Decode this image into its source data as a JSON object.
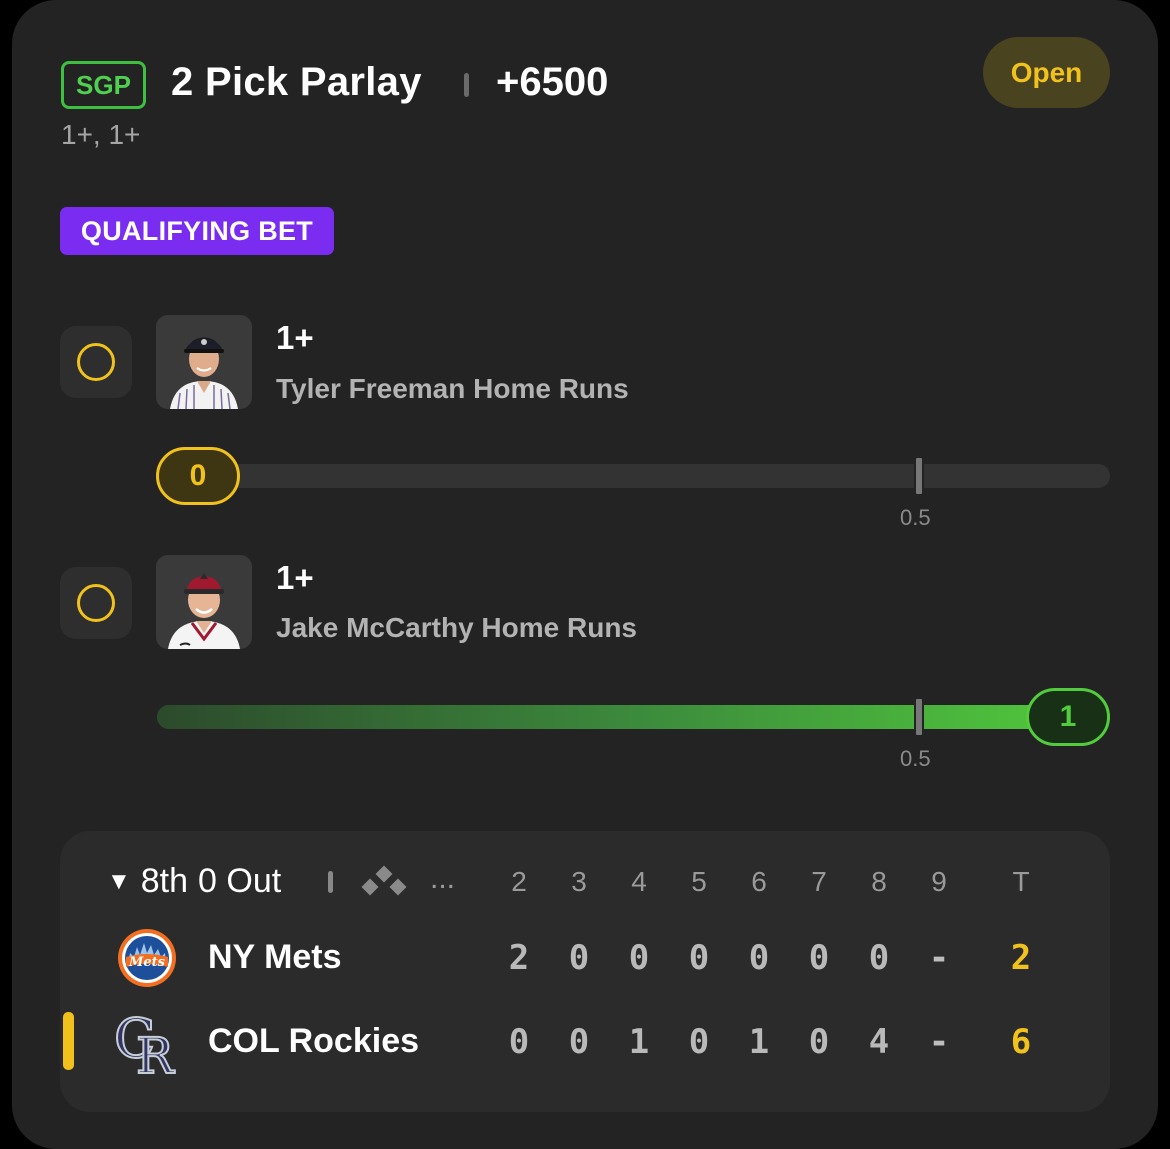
{
  "header": {
    "tag": "SGP",
    "title": "2 Pick Parlay",
    "odds": "+6500",
    "subline": "1+, 1+",
    "status": "Open"
  },
  "promo_badge": "QUALIFYING BET",
  "picks": [
    {
      "line": "1+",
      "description": "Tyler Freeman Home Runs",
      "current_value": "0",
      "target_label": "0.5",
      "progress_fraction": 0.0,
      "status_color": "#f1c21b"
    },
    {
      "line": "1+",
      "description": "Jake McCarthy Home Runs",
      "current_value": "1",
      "target_label": "0.5",
      "progress_fraction": 1.0,
      "status_color": "#52cc3c"
    }
  ],
  "scoreboard": {
    "inning": "8th",
    "outs": "0 Out",
    "ellipsis": "...",
    "innings": [
      "2",
      "3",
      "4",
      "5",
      "6",
      "7",
      "8",
      "9"
    ],
    "total_label": "T",
    "teams": [
      {
        "name": "NY Mets",
        "scores": [
          "2",
          "0",
          "0",
          "0",
          "0",
          "0",
          "0",
          "-"
        ],
        "total": "2",
        "logo": "mets-logo"
      },
      {
        "name": "COL Rockies",
        "scores": [
          "0",
          "0",
          "1",
          "0",
          "1",
          "0",
          "4",
          "-"
        ],
        "total": "6",
        "logo": "rockies-logo"
      }
    ]
  },
  "colors": {
    "accent_yellow": "#f1c21b",
    "accent_green": "#52cc3c",
    "badge_purple": "#7a2cf0",
    "card_bg": "#232323"
  }
}
